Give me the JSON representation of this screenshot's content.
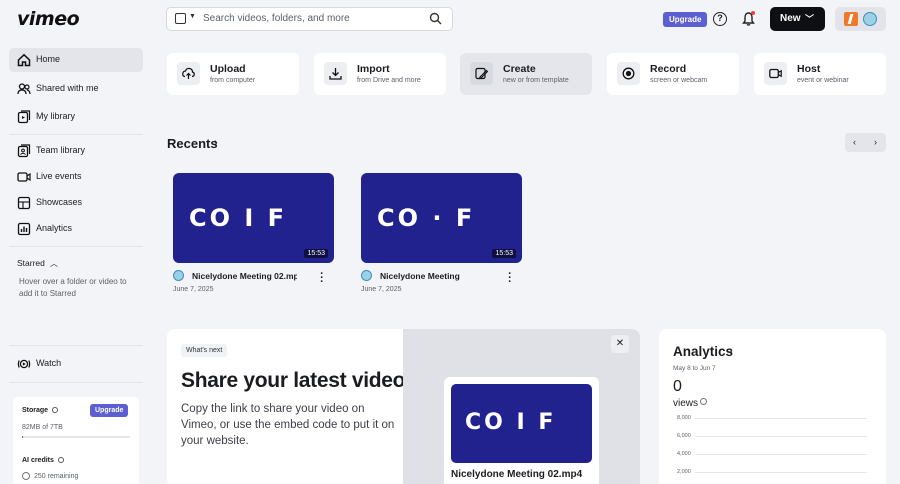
{
  "header": {
    "logo": "vimeo",
    "search_placeholder": "Search videos, folders, and more",
    "upgrade_label": "Upgrade",
    "help_glyph": "?",
    "new_label": "New"
  },
  "sidebar": {
    "items": [
      {
        "label": "Home",
        "icon": "home-icon"
      },
      {
        "label": "Shared with me",
        "icon": "people-icon"
      },
      {
        "label": "My library",
        "icon": "library-icon"
      },
      {
        "label": "Team library",
        "icon": "team-library-icon"
      },
      {
        "label": "Live events",
        "icon": "live-icon"
      },
      {
        "label": "Showcases",
        "icon": "showcase-icon"
      },
      {
        "label": "Analytics",
        "icon": "analytics-icon"
      }
    ],
    "starred_heading": "Starred",
    "starred_hint": "Hover over a folder or video to add it to Starred",
    "watch_label": "Watch",
    "storage": {
      "title": "Storage",
      "upgrade_label": "Upgrade",
      "used": "82MB of 7TB",
      "fraction": 0.01,
      "ai_title": "AI credits",
      "ai_remaining": "250 remaining"
    }
  },
  "actions": [
    {
      "title": "Upload",
      "subtitle": "from computer"
    },
    {
      "title": "Import",
      "subtitle": "from Drive and more"
    },
    {
      "title": "Create",
      "subtitle": "new or from template"
    },
    {
      "title": "Record",
      "subtitle": "screen or webcam"
    },
    {
      "title": "Host",
      "subtitle": "event or webinar"
    }
  ],
  "recents": {
    "title": "Recents",
    "videos": [
      {
        "title": "Nicelydone Meeting 02.mp4",
        "date": "June 7, 2025",
        "duration": "15:53",
        "art": "CO I F"
      },
      {
        "title": "Nicelydone Meeting",
        "date": "June 7, 2025",
        "duration": "15:53",
        "art": "CO · F"
      }
    ]
  },
  "share_panel": {
    "tag": "What's next",
    "heading": "Share your latest video",
    "body": "Copy the link to share your video on Vimeo, or use the embed code to put it on your website.",
    "card_title": "Nicelydone Meeting 02.mp4",
    "card_art": "CO I F"
  },
  "analytics": {
    "title": "Analytics",
    "range": "May 8 to Jun 7",
    "total": "0",
    "metric": "views",
    "ticks": [
      "8,000",
      "6,000",
      "4,000",
      "2,000"
    ]
  },
  "colors": {
    "brand": "#5b5fcf",
    "thumb": "#22228f",
    "accent_orange": "#f07828"
  }
}
